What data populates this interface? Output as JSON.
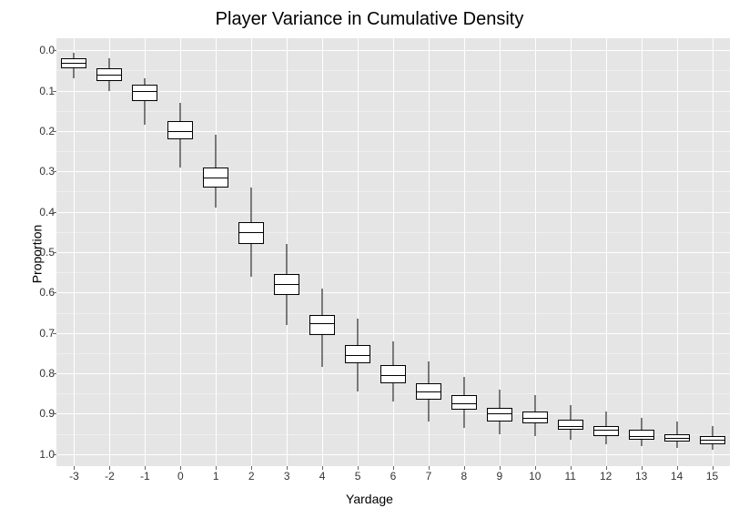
{
  "chart_data": {
    "type": "boxplot",
    "title": "Player Variance in Cumulative Density",
    "xlabel": "Yardage",
    "ylabel": "Proportion",
    "x_categories": [
      -3,
      -2,
      -1,
      0,
      1,
      2,
      3,
      4,
      5,
      6,
      7,
      8,
      9,
      10,
      11,
      12,
      13,
      14,
      15
    ],
    "y_ticks": [
      0.0,
      0.1,
      0.2,
      0.3,
      0.4,
      0.5,
      0.6,
      0.7,
      0.8,
      0.9,
      1.0
    ],
    "y_reversed": true,
    "ylim": [
      0.0,
      1.0
    ],
    "series": [
      {
        "x": -3,
        "lower_whisker": 0.005,
        "q1": 0.02,
        "median": 0.03,
        "q3": 0.045,
        "upper_whisker": 0.07
      },
      {
        "x": -2,
        "lower_whisker": 0.02,
        "q1": 0.045,
        "median": 0.06,
        "q3": 0.075,
        "upper_whisker": 0.1
      },
      {
        "x": -1,
        "lower_whisker": 0.07,
        "q1": 0.085,
        "median": 0.1,
        "q3": 0.125,
        "upper_whisker": 0.185
      },
      {
        "x": 0,
        "lower_whisker": 0.13,
        "q1": 0.175,
        "median": 0.2,
        "q3": 0.22,
        "upper_whisker": 0.29
      },
      {
        "x": 1,
        "lower_whisker": 0.21,
        "q1": 0.29,
        "median": 0.315,
        "q3": 0.34,
        "upper_whisker": 0.39
      },
      {
        "x": 2,
        "lower_whisker": 0.34,
        "q1": 0.425,
        "median": 0.45,
        "q3": 0.48,
        "upper_whisker": 0.56
      },
      {
        "x": 3,
        "lower_whisker": 0.48,
        "q1": 0.555,
        "median": 0.58,
        "q3": 0.605,
        "upper_whisker": 0.68
      },
      {
        "x": 4,
        "lower_whisker": 0.59,
        "q1": 0.655,
        "median": 0.675,
        "q3": 0.705,
        "upper_whisker": 0.785
      },
      {
        "x": 5,
        "lower_whisker": 0.665,
        "q1": 0.73,
        "median": 0.755,
        "q3": 0.775,
        "upper_whisker": 0.845
      },
      {
        "x": 6,
        "lower_whisker": 0.72,
        "q1": 0.78,
        "median": 0.805,
        "q3": 0.825,
        "upper_whisker": 0.87
      },
      {
        "x": 7,
        "lower_whisker": 0.77,
        "q1": 0.825,
        "median": 0.845,
        "q3": 0.865,
        "upper_whisker": 0.92
      },
      {
        "x": 8,
        "lower_whisker": 0.81,
        "q1": 0.855,
        "median": 0.875,
        "q3": 0.89,
        "upper_whisker": 0.935
      },
      {
        "x": 9,
        "lower_whisker": 0.84,
        "q1": 0.885,
        "median": 0.9,
        "q3": 0.92,
        "upper_whisker": 0.95
      },
      {
        "x": 10,
        "lower_whisker": 0.855,
        "q1": 0.895,
        "median": 0.91,
        "q3": 0.925,
        "upper_whisker": 0.955
      },
      {
        "x": 11,
        "lower_whisker": 0.88,
        "q1": 0.915,
        "median": 0.93,
        "q3": 0.94,
        "upper_whisker": 0.965
      },
      {
        "x": 12,
        "lower_whisker": 0.895,
        "q1": 0.93,
        "median": 0.94,
        "q3": 0.955,
        "upper_whisker": 0.975
      },
      {
        "x": 13,
        "lower_whisker": 0.91,
        "q1": 0.94,
        "median": 0.955,
        "q3": 0.965,
        "upper_whisker": 0.98
      },
      {
        "x": 14,
        "lower_whisker": 0.92,
        "q1": 0.95,
        "median": 0.96,
        "q3": 0.97,
        "upper_whisker": 0.985
      },
      {
        "x": 15,
        "lower_whisker": 0.93,
        "q1": 0.955,
        "median": 0.965,
        "q3": 0.975,
        "upper_whisker": 0.99
      }
    ]
  }
}
